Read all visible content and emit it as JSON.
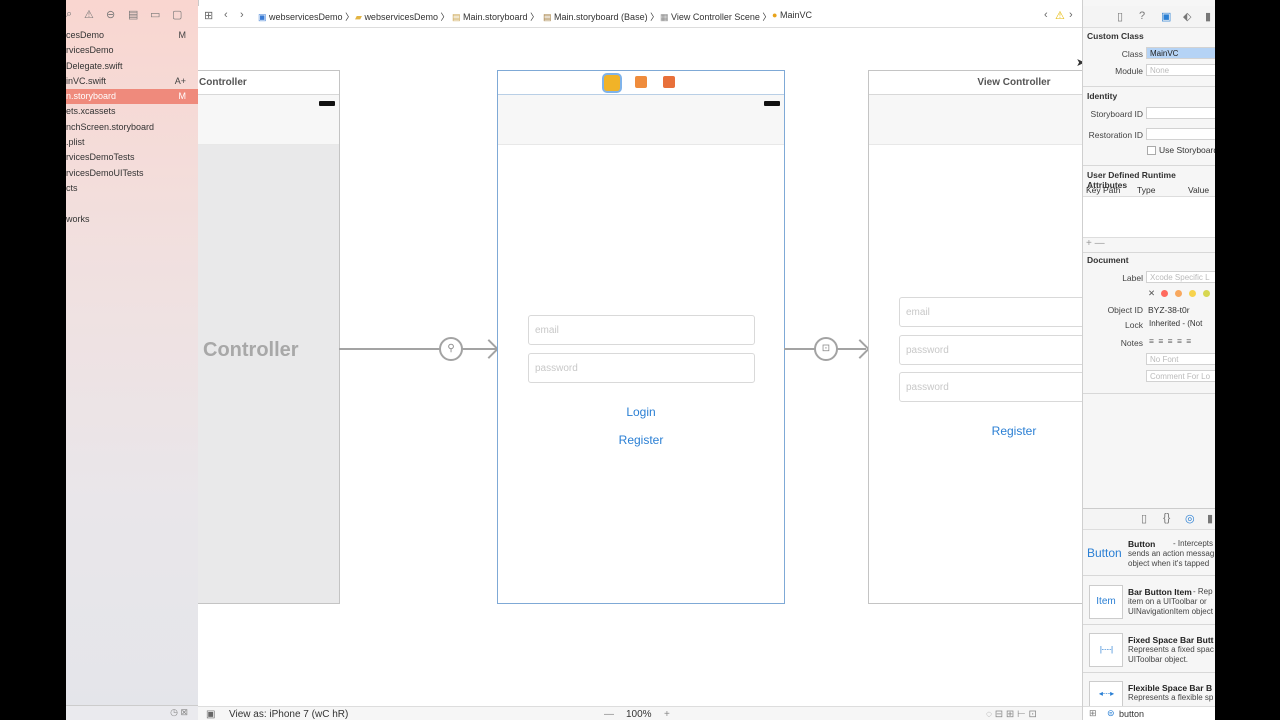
{
  "navigator": {
    "items": [
      {
        "name": "cesDemo",
        "badge": "M"
      },
      {
        "name": "rvicesDemo",
        "badge": ""
      },
      {
        "name": "Delegate.swift",
        "badge": ""
      },
      {
        "name": "inVC.swift",
        "badge": "A+"
      },
      {
        "name": "n.storyboard",
        "badge": "M"
      },
      {
        "name": "ets.xcassets",
        "badge": ""
      },
      {
        "name": "nchScreen.storyboard",
        "badge": ""
      },
      {
        "name": ".plist",
        "badge": ""
      },
      {
        "name": "rvicesDemoTests",
        "badge": ""
      },
      {
        "name": "rvicesDemoUITests",
        "badge": ""
      },
      {
        "name": "cts",
        "badge": ""
      },
      {
        "name": "",
        "badge": ""
      },
      {
        "name": "works",
        "badge": ""
      }
    ]
  },
  "jumpbar": {
    "crumbs": [
      "webservicesDemo",
      "webservicesDemo",
      "Main.storyboard",
      "Main.storyboard (Base)",
      "View Controller Scene",
      "MainVC"
    ]
  },
  "canvas": {
    "scene1": {
      "title": "Controller",
      "big_label": "Controller"
    },
    "scene2": {
      "email_placeholder": "email",
      "password_placeholder": "password",
      "login": "Login",
      "register": "Register"
    },
    "scene3": {
      "title": "View Controller",
      "email_placeholder": "email",
      "password_placeholder": "password",
      "password2_placeholder": "password",
      "register": "Register"
    }
  },
  "bottombar": {
    "view_as": "View as: iPhone 7 (wC hR)",
    "zoom": "100%"
  },
  "inspector": {
    "custom_class": {
      "title": "Custom Class",
      "class_label": "Class",
      "class_value": "MainVC",
      "module_label": "Module",
      "module_value": "None"
    },
    "identity": {
      "title": "Identity",
      "storyboard_id_label": "Storyboard ID",
      "restoration_id_label": "Restoration ID",
      "use_storyboard_label": "Use Storyboard"
    },
    "runtime_attrs": {
      "title": "User Defined Runtime Attributes",
      "cols": [
        "Key Path",
        "Type",
        "Value"
      ]
    },
    "document": {
      "title": "Document",
      "label_label": "Label",
      "label_placeholder": "Xcode Specific L",
      "object_id_label": "Object ID",
      "object_id_value": "BYZ-38-t0r",
      "lock_label": "Lock",
      "lock_value": "Inherited - (Not",
      "notes_label": "Notes",
      "font_placeholder": "No Font",
      "comment_placeholder": "Comment For Lo"
    },
    "label_colors": [
      "#ff6a5f",
      "#f8a85e",
      "#f7d34d",
      "#d7d751"
    ]
  },
  "library": {
    "items": [
      {
        "thumb": "Button",
        "name": "Button",
        "desc": [
          "- Intercepts tou",
          "sends an action messag",
          "object when it's tapped"
        ]
      },
      {
        "thumb": "Item",
        "name": "Bar Button Item",
        "desc": [
          "- Rep",
          "item on a UIToolbar or",
          "UINavigationItem object"
        ]
      },
      {
        "thumb": "fixed",
        "name": "Fixed Space Bar Butt",
        "desc": [
          "Represents a fixed spac",
          "UIToolbar object."
        ]
      },
      {
        "thumb": "flexible",
        "name": "Flexible Space Bar B",
        "desc": [
          "Represents a flexible sp"
        ]
      }
    ],
    "filter_value": "button"
  }
}
